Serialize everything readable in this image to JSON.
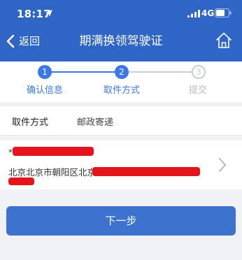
{
  "status_bar": {
    "time": "18:17",
    "network": "4G",
    "location_icon": "location-arrow-icon",
    "signal_icon": "signal-bars-icon",
    "battery_icon": "battery-icon"
  },
  "nav": {
    "back_label": "返回",
    "title": "期满换领驾驶证",
    "home_icon": "home-icon",
    "back_icon": "chevron-left-icon"
  },
  "steps": [
    {
      "number": "1",
      "label": "确认信息",
      "state": "completed"
    },
    {
      "number": "2",
      "label": "取件方式",
      "state": "current"
    },
    {
      "number": "3",
      "label": "提交",
      "state": "pending"
    }
  ],
  "pickup": {
    "label": "取件方式",
    "value": "邮政寄递"
  },
  "address": {
    "asterisk": "*",
    "address_prefix": "北京北京市朝阳区北京"
  },
  "next_button": {
    "label": "下一步"
  },
  "colors": {
    "header": "#2f66c6",
    "accent": "#3b78e7",
    "button": "#3d73ce",
    "redaction": "#e3141a"
  }
}
